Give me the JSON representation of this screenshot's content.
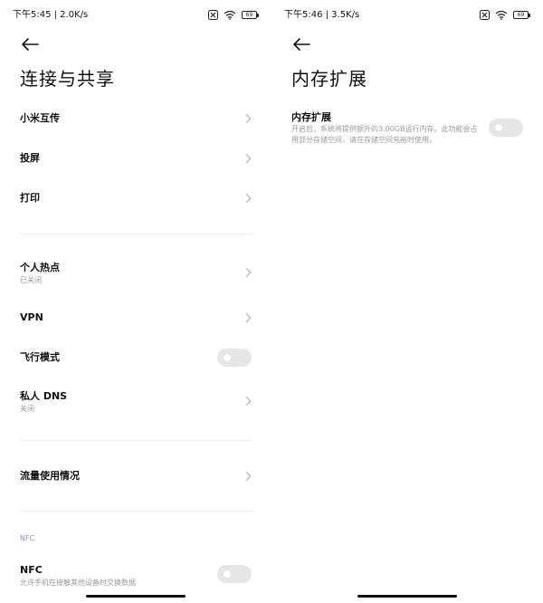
{
  "left": {
    "status": {
      "text": "下午5:45 | 2.0K/s",
      "battery": "69"
    },
    "title": "连接与共享",
    "items": [
      {
        "title": "小米互传"
      },
      {
        "title": "投屏"
      },
      {
        "title": "打印"
      },
      {
        "title": "个人热点",
        "subtitle": "已关闭"
      },
      {
        "title": "VPN"
      },
      {
        "title": "飞行模式",
        "enabled": false
      },
      {
        "title": "私人 DNS",
        "subtitle": "关闭"
      },
      {
        "title": "流量使用情况"
      }
    ],
    "nfc_section": {
      "header": "NFC",
      "title": "NFC",
      "subtitle": "允许手机在接触其他设备时交换数据",
      "enabled": false
    }
  },
  "right": {
    "status": {
      "text": "下午5:46 | 3.5K/s",
      "battery": "69"
    },
    "title": "内存扩展",
    "setting": {
      "title": "内存扩展",
      "description": "开启后，系统将提供额外的3.00GB运行内存。此功能会占用部分存储空间，请在存储空间充裕时使用。",
      "enabled": false
    }
  },
  "colors": {
    "toggle_off": "#e6e6e6",
    "section_header": "#8a8fb8",
    "subtitle": "#999999",
    "divider": "#ececec"
  }
}
